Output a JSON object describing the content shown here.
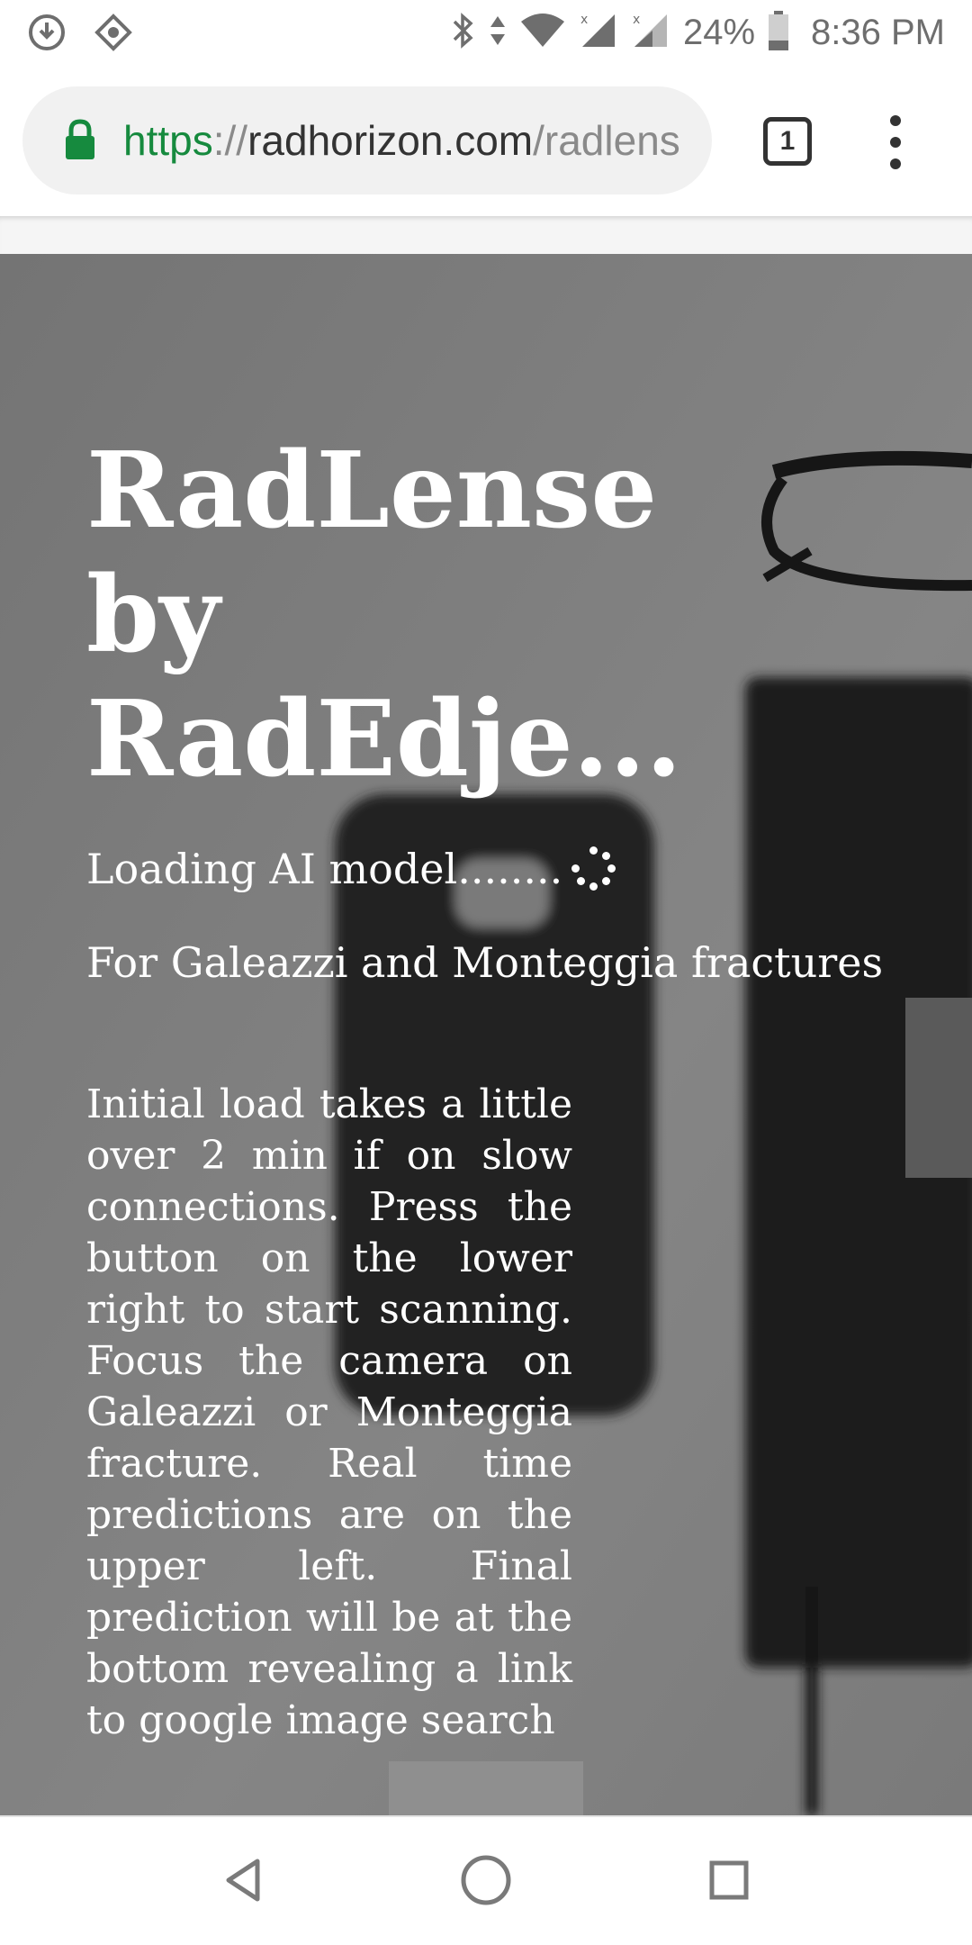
{
  "status_bar": {
    "battery": "24%",
    "time": "8:36 PM",
    "icons": [
      "download-icon",
      "vpn-icon",
      "bluetooth-icon",
      "data-arrows-icon",
      "wifi-icon",
      "signal-icon",
      "signal-icon",
      "battery-icon"
    ]
  },
  "browser": {
    "url_scheme": "https",
    "url_separator": "://",
    "url_host": "radhorizon.com",
    "url_path": "/radlens",
    "tab_count": "1",
    "colors": {
      "secure": "#168a3e"
    }
  },
  "hero": {
    "title": "RadLense by RadEdje...",
    "loading_text": "Loading AI model........",
    "subtitle": "For Galeazzi and Monteggia fractures",
    "instructions": "Initial load takes a little over 2 min if on slow connections. Press the button on the lower right to start scanning. Focus the camera on Galeazzi or Monteggia fracture. Real time predictions are on the upper left. Final prediction will be at the bottom revealing a link to google image search"
  },
  "nav_bar": {
    "buttons": [
      "back-icon",
      "home-icon",
      "recents-icon"
    ]
  }
}
